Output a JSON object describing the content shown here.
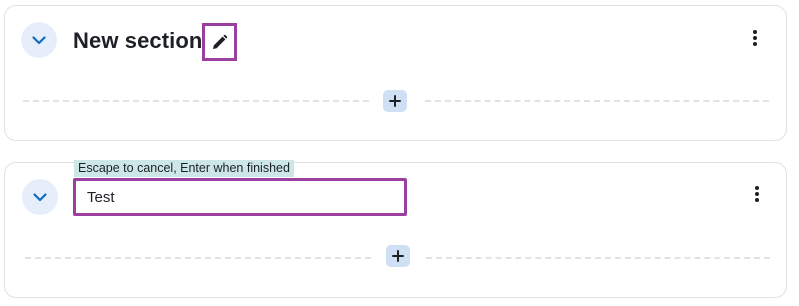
{
  "sections": [
    {
      "title": "New section",
      "collapse_icon": "chevron-down-icon",
      "edit_icon": "pencil-icon",
      "menu_icon": "kebab-icon",
      "add_icon": "plus-icon"
    },
    {
      "edit_hint": "Escape to cancel, Enter when finished",
      "name_input_value": "Test",
      "collapse_icon": "chevron-down-icon",
      "menu_icon": "kebab-icon",
      "add_icon": "plus-icon"
    }
  ],
  "colors": {
    "accent": "#0f6cbf",
    "highlight_border": "#9b3fa0",
    "hint_bg": "#cde7e6",
    "chevron_bg": "#e7eefb",
    "add_bg": "#cfe0f5"
  }
}
